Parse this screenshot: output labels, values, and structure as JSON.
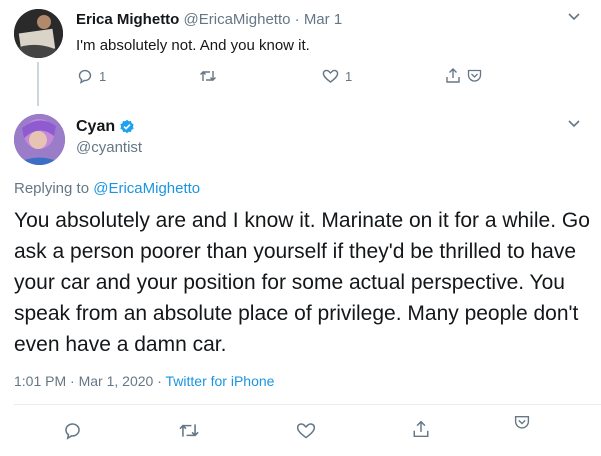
{
  "parent_tweet": {
    "name": "Erica Mighetto",
    "handle": "@EricaMighetto",
    "separator": "·",
    "date": "Mar 1",
    "text": "I'm absolutely not. And you know it.",
    "reply_count": "1",
    "like_count": "1",
    "icons": [
      "reply-icon",
      "retweet-icon",
      "like-icon",
      "share-icon",
      "caret-down-icon"
    ]
  },
  "main_tweet": {
    "name": "Cyan",
    "handle": "@cyantist",
    "verified": true,
    "replying_prefix": "Replying to",
    "replying_to": "@EricaMighetto",
    "text": "You absolutely are and I know it. Marinate on it for a while. Go ask a person poorer than yourself if they'd be thrilled to have your car and your position for some actual perspective. You speak from an absolute place of privilege. Many people don't even have a damn car.",
    "time": "1:01 PM",
    "separator": "·",
    "date": "Mar 1, 2020",
    "source": "Twitter for iPhone",
    "icons": [
      "reply-icon",
      "retweet-icon",
      "like-icon",
      "share-icon",
      "caret-down-icon"
    ]
  },
  "colors": {
    "link": "#1b95e0",
    "muted": "#657786",
    "text": "#14171a",
    "verified": "#1da1f2",
    "divider": "#e6ecf0"
  }
}
